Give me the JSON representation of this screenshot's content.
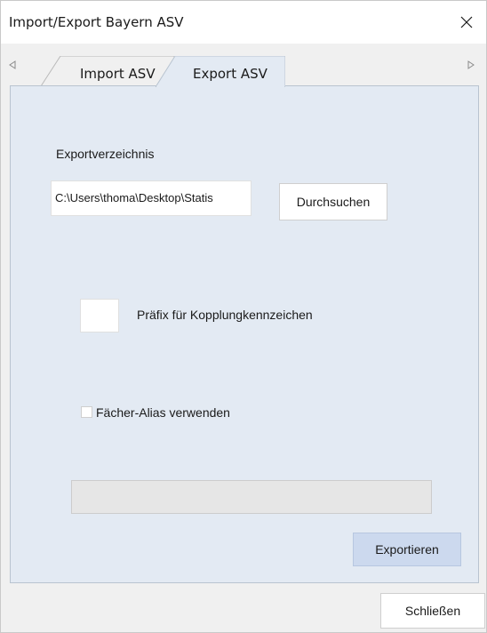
{
  "window": {
    "title": "Import/Export Bayern ASV",
    "close_icon": "close-icon"
  },
  "tabs": [
    {
      "label": "Import ASV",
      "selected": false
    },
    {
      "label": "Export ASV",
      "selected": true
    }
  ],
  "export": {
    "directory_label": "Exportverzeichnis",
    "directory_value": "C:\\Users\\thoma\\Desktop\\Statis",
    "browse_label": "Durchsuchen",
    "prefix_label": "Präfix für Kopplungkennzeichen",
    "prefix_value": "",
    "alias_label": "Fächer-Alias verwenden",
    "alias_checked": false,
    "progress_fraction": 0,
    "export_label": "Exportieren"
  },
  "footer": {
    "close_label": "Schließen"
  },
  "colors": {
    "panel_bg": "#e3eaf3",
    "primary_button_bg": "#ccd9ee",
    "window_bg": "#f0f0f0"
  }
}
